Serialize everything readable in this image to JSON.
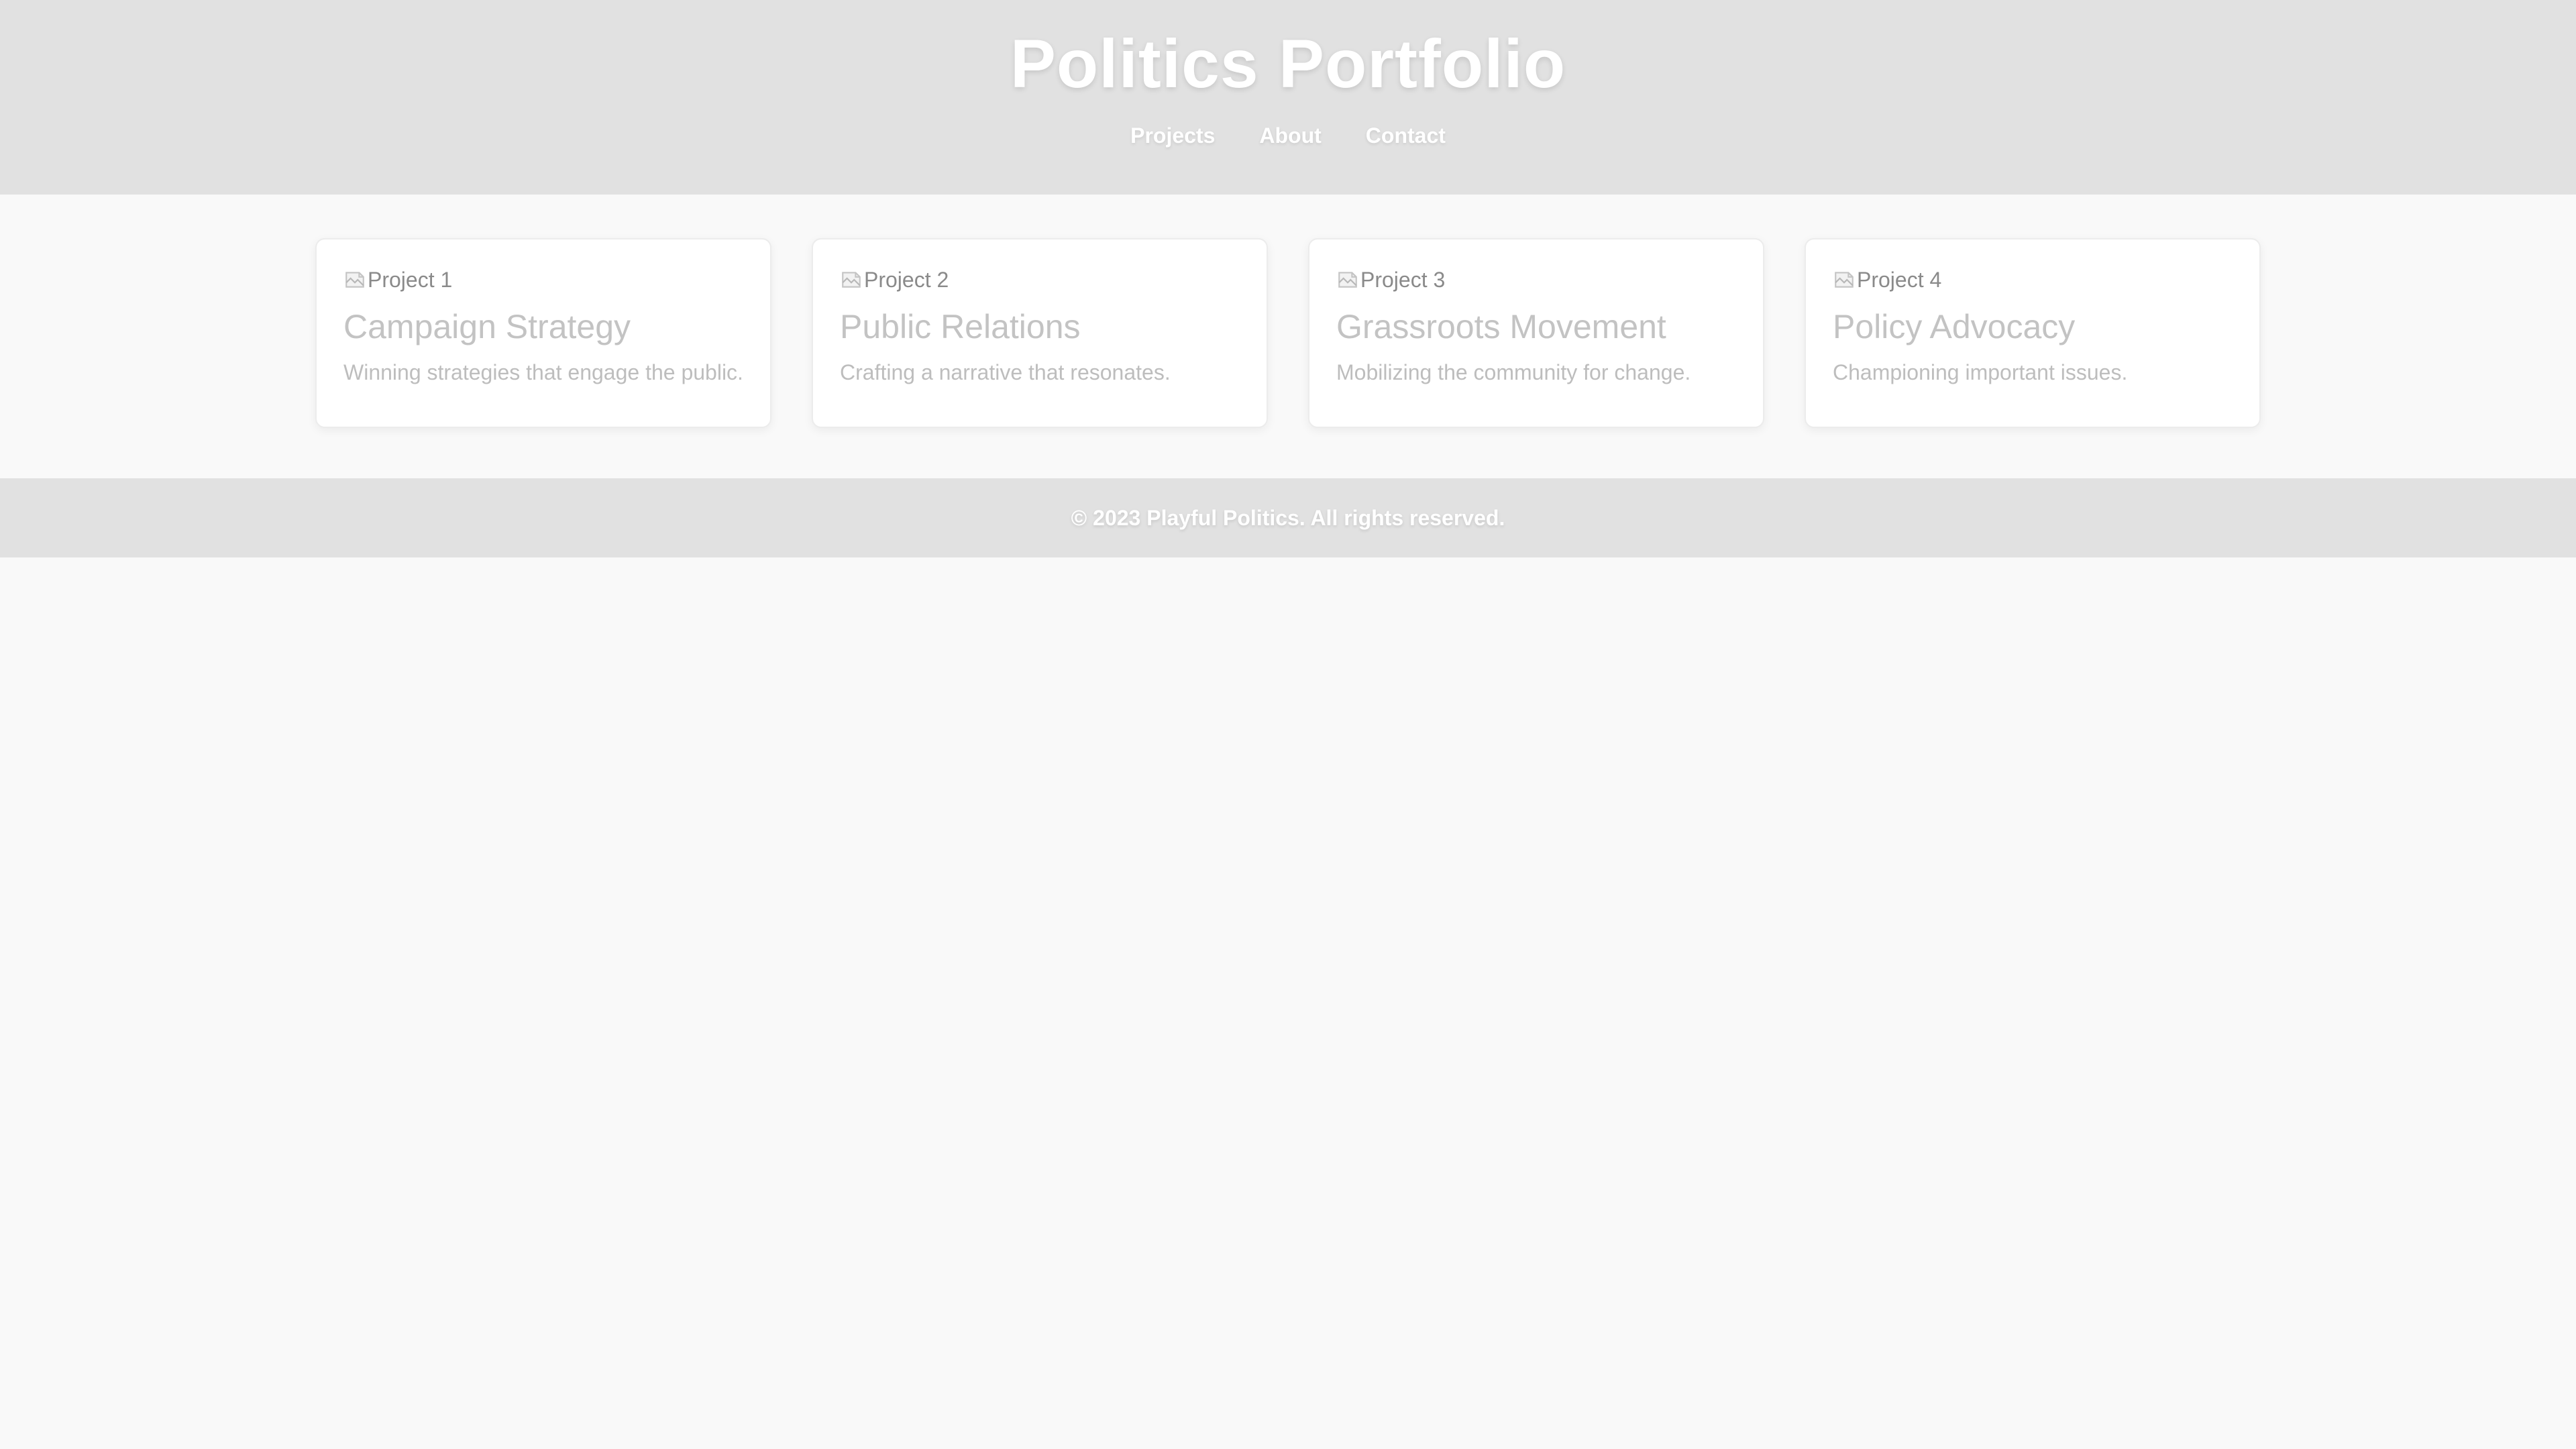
{
  "header": {
    "title": "Politics Portfolio",
    "nav": [
      {
        "label": "Projects"
      },
      {
        "label": "About"
      },
      {
        "label": "Contact"
      }
    ]
  },
  "projects": [
    {
      "image_alt": "Project 1",
      "title": "Campaign Strategy",
      "description": "Winning strategies that engage the public."
    },
    {
      "image_alt": "Project 2",
      "title": "Public Relations",
      "description": "Crafting a narrative that resonates."
    },
    {
      "image_alt": "Project 3",
      "title": "Grassroots Movement",
      "description": "Mobilizing the community for change."
    },
    {
      "image_alt": "Project 4",
      "title": "Policy Advocacy",
      "description": "Championing important issues."
    }
  ],
  "footer": {
    "text": "© 2023 Playful Politics. All rights reserved."
  },
  "colors": {
    "header_bg": "#e1e1e1",
    "page_bg": "#f9f9f9",
    "card_bg": "#ffffff"
  },
  "icons": {
    "card_image": "broken-image-icon"
  }
}
